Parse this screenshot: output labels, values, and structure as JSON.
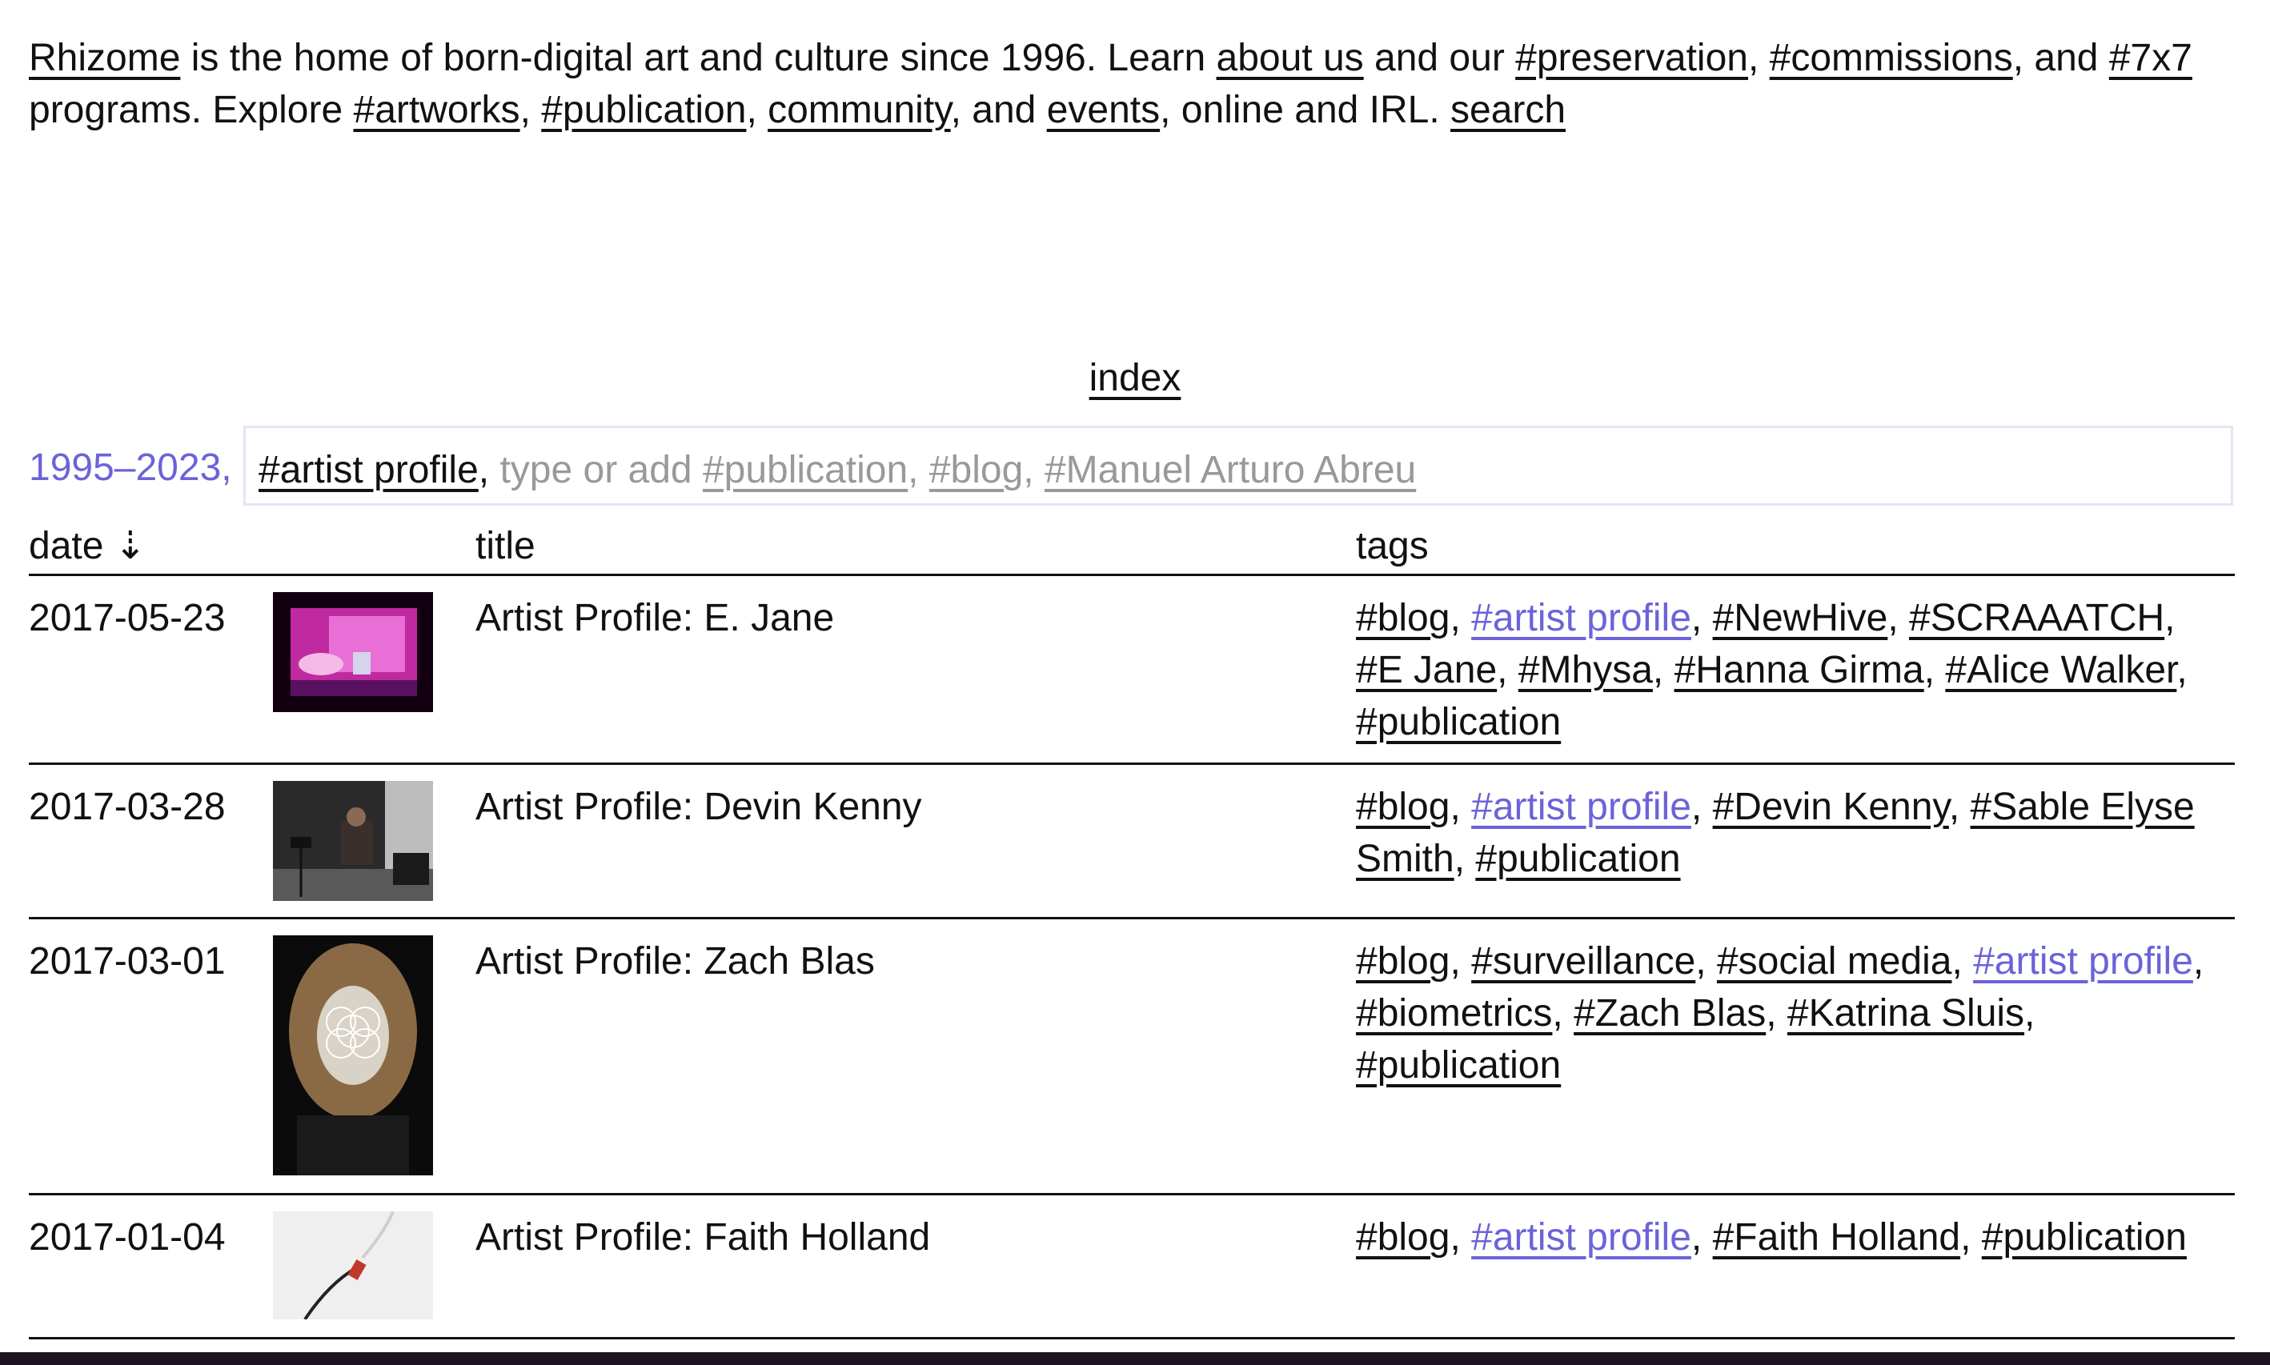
{
  "intro": {
    "rhizome": "Rhizome",
    "t1": " is the home of born-digital art and culture since 1996. Learn ",
    "about_us": "about us",
    "t2": " and our ",
    "preservation": "#preservation",
    "c1": ", ",
    "commissions": "#commissions",
    "t3": ", and ",
    "sevenx7": "#7x7",
    "t4": " programs. Explore ",
    "artworks": "#artworks",
    "c2": ", ",
    "publication": "#publication",
    "c3": ", ",
    "community": "community",
    "t5": ", and ",
    "events": "events",
    "t6": ", online and IRL. ",
    "search": "search"
  },
  "index_label": "index",
  "filter": {
    "range": "1995–2023,",
    "active_tag": "#artist profile",
    "sep": ", ",
    "placeholder": "type or add ",
    "suggestions": [
      "#publication",
      "#blog",
      "#Manuel Arturo Abreu"
    ]
  },
  "columns": {
    "date": "date ⇣",
    "title": "title",
    "tags": "tags"
  },
  "rows": [
    {
      "date": "2017-05-23",
      "title": "Artist Profile: E. Jane",
      "tags": [
        "#blog",
        "#artist profile",
        "#NewHive",
        "#SCRAAATCH",
        "#E Jane",
        "#Mhysa",
        "#Hanna Girma",
        "#Alice Walker",
        "#publication"
      ]
    },
    {
      "date": "2017-03-28",
      "title": "Artist Profile: Devin Kenny",
      "tags": [
        "#blog",
        "#artist profile",
        "#Devin Kenny",
        "#Sable Elyse Smith",
        "#publication"
      ]
    },
    {
      "date": "2017-03-01",
      "title": "Artist Profile: Zach Blas",
      "tags": [
        "#blog",
        "#surveillance",
        "#social media",
        "#artist profile",
        "#biometrics",
        "#Zach Blas",
        "#Katrina Sluis",
        "#publication"
      ]
    },
    {
      "date": "2017-01-04",
      "title": "Artist Profile: Faith Holland",
      "tags": [
        "#blog",
        "#artist profile",
        "#Faith Holland",
        "#publication"
      ]
    }
  ],
  "colors": {
    "accent": "#6b63d9",
    "text": "#111111",
    "placeholder": "#999999"
  }
}
